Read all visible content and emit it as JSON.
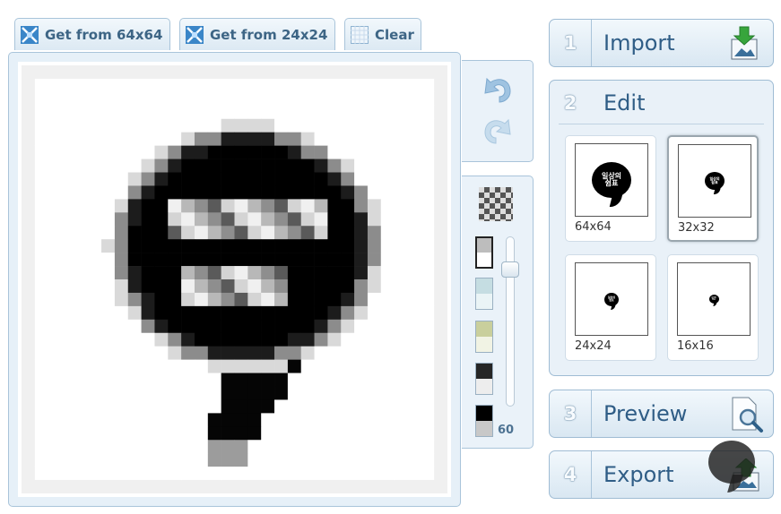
{
  "toolbar": {
    "get64_label": "Get from 64x64",
    "get24_label": "Get from 24x24",
    "clear_label": "Clear"
  },
  "palette": {
    "opacity_value": "60"
  },
  "steps": {
    "import": {
      "number": "1",
      "label": "Import"
    },
    "edit": {
      "number": "2",
      "label": "Edit"
    },
    "preview": {
      "number": "3",
      "label": "Preview"
    },
    "export": {
      "number": "4",
      "label": "Export"
    }
  },
  "sizes": [
    {
      "label": "64x64",
      "icon_text": "일상의\n쉼표"
    },
    {
      "label": "32x32",
      "icon_text": "일상의\n쉼표"
    },
    {
      "label": "24x24",
      "icon_text": "일상의\n쉼표"
    },
    {
      "label": "16x16",
      "icon_text": "일상의\n쉼표"
    }
  ],
  "colors": {
    "accent": "#2f5d86",
    "panel_bg": "#e6f0f8",
    "border": "#a9c4da"
  }
}
